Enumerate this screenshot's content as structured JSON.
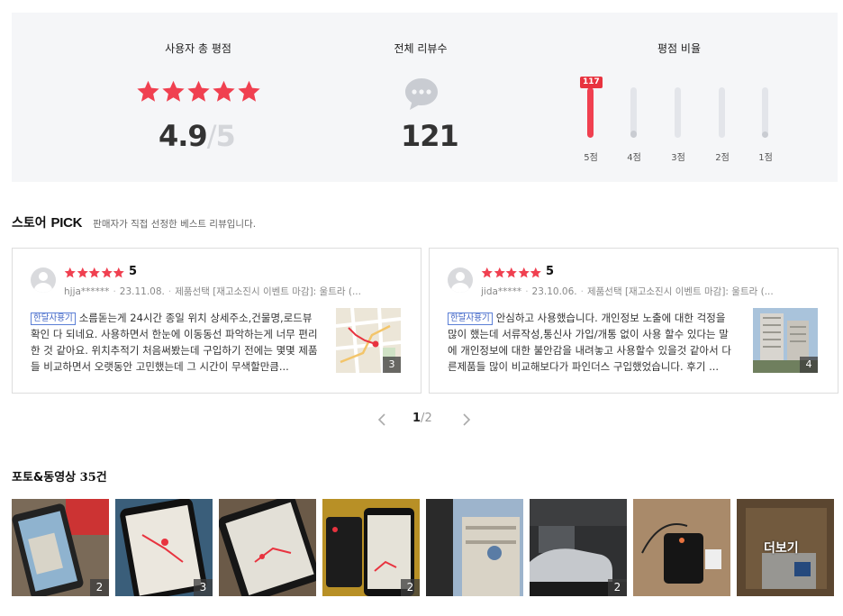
{
  "summary": {
    "avg_title": "사용자 총 평점",
    "avg_score": "4.9",
    "avg_sep": "/",
    "avg_max": "5",
    "avg_stars": 5,
    "total_title": "전체 리뷰수",
    "total_count": "121",
    "ratio_title": "평점 비율",
    "ratio_bars": [
      {
        "label": "5점",
        "count": "117",
        "fraction": 1.0,
        "highlight": true
      },
      {
        "label": "4점",
        "fraction": 0.15,
        "highlight": false
      },
      {
        "label": "3점",
        "fraction": 0.0,
        "highlight": false
      },
      {
        "label": "2점",
        "fraction": 0.0,
        "highlight": false
      },
      {
        "label": "1점",
        "fraction": 0.12,
        "highlight": false
      }
    ]
  },
  "store_pick": {
    "title_prefix": "스토어",
    "title_pick": "PICK",
    "description": "판매자가 직접 선정한 베스트 리뷰입니다.",
    "reviews": [
      {
        "rating": "5",
        "user": "hjja******",
        "date": "23.11.08.",
        "option": "제품선택 [재고소진시 이벤트 마감]: 울트라 (...",
        "tag": "한달사용기",
        "text": "소름돋는게 24시간 종일 위치 상세주소,건물명,로드뷰 확인 다 되네요. 사용하면서 한눈에 이동동선 파악하는게 너무 편리한 것 같아요. 위치추적기 처음써봤는데 구입하기 전에는 몇몇 제품들 비교하면서 오랫동안 고민했는데 그 시간이 무색할만큼...",
        "photo_count": "3",
        "thumb_icon": "map-thumbnail"
      },
      {
        "rating": "5",
        "user": "jida*****",
        "date": "23.10.06.",
        "option": "제품선택 [재고소진시 이벤트 마감]: 울트라 (...",
        "tag": "한달사용기",
        "text": "안심하고 사용했습니다. 개인정보 노출에 대한 걱정을 많이 했는데 서류작성,통신사 가입/개통 없이 사용 할수 있다는 말에 개인정보에 대한 불안감을 내려놓고 사용할수 있을것 같아서 다른제품들 많이 비교해보다가 파인더스 구입했었습니다. 후기 ...",
        "photo_count": "4",
        "thumb_icon": "building-thumbnail"
      }
    ],
    "pager": {
      "current": "1",
      "sep": "/",
      "total": "2"
    }
  },
  "photos": {
    "title": "포토&동영상",
    "count": "35건",
    "items": [
      {
        "icon": "phone-map-photo",
        "count": "2"
      },
      {
        "icon": "map-route-photo",
        "count": "3"
      },
      {
        "icon": "phone-route-photo",
        "count": ""
      },
      {
        "icon": "device-phone-photo",
        "count": "2"
      },
      {
        "icon": "building-photo",
        "count": ""
      },
      {
        "icon": "parking-car-photo",
        "count": "2"
      },
      {
        "icon": "tracker-device-photo",
        "count": ""
      },
      {
        "icon": "box-photo",
        "count": ""
      }
    ],
    "more_label": "더보기"
  },
  "colors": {
    "accent": "#f04050",
    "star": "#f04050",
    "panel": "#f5f6f8"
  }
}
